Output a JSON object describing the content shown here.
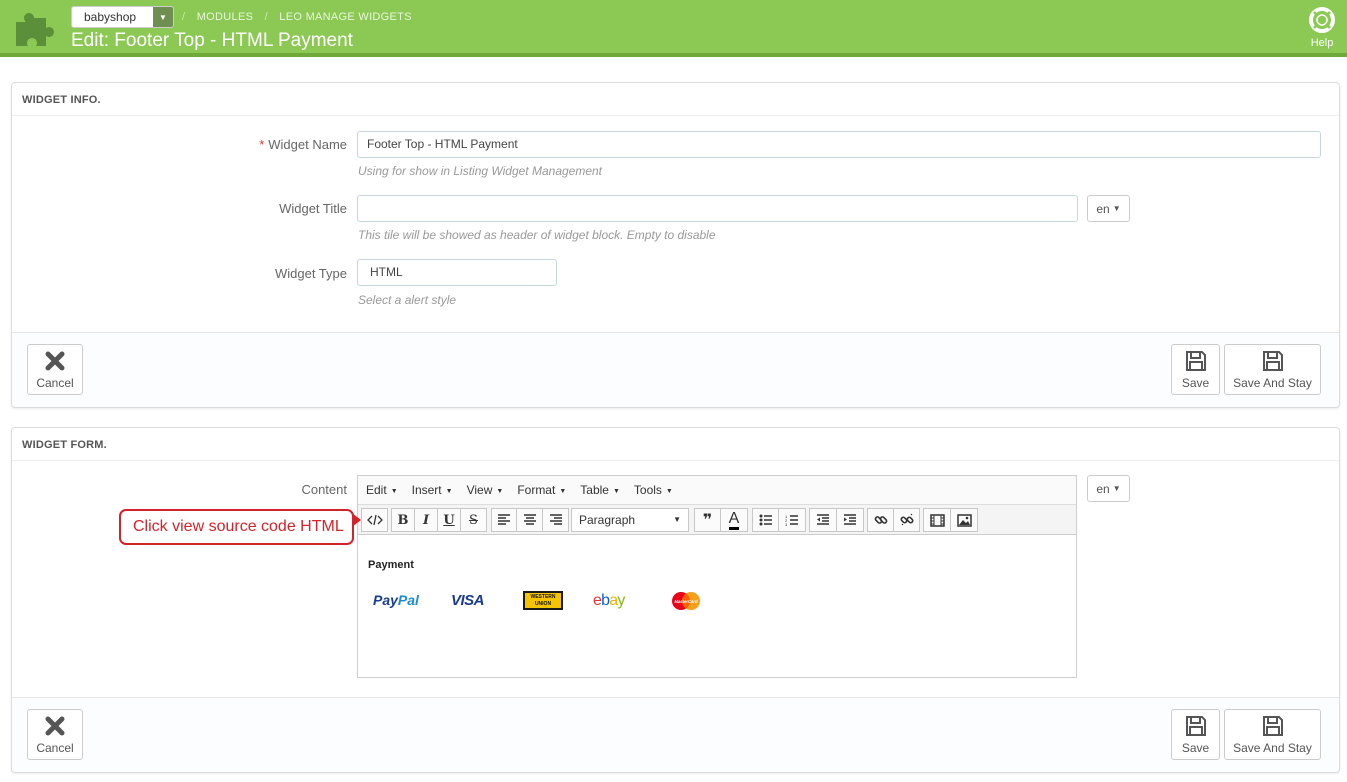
{
  "header": {
    "shop": "babyshop",
    "breadcrumb": [
      "MODULES",
      "LEO MANAGE WIDGETS"
    ],
    "title": "Edit: Footer Top - HTML Payment",
    "help_label": "Help"
  },
  "widget_info": {
    "heading": "WIDGET INFO.",
    "name_label": "Widget Name",
    "name_value": "Footer Top - HTML Payment",
    "name_hint": "Using for show in Listing Widget Management",
    "title_label": "Widget Title",
    "title_value": "",
    "title_hint": "This tile will be showed as header of widget block. Empty to disable",
    "type_label": "Widget Type",
    "type_value": "HTML",
    "type_hint": "Select a alert style",
    "lang": "en"
  },
  "widget_form": {
    "heading": "WIDGET FORM.",
    "content_label": "Content",
    "lang": "en",
    "menu": [
      "Edit",
      "Insert",
      "View",
      "Format",
      "Table",
      "Tools"
    ],
    "paragraph": "Paragraph",
    "content_heading": "Payment",
    "logos": {
      "paypal_a": "Pay",
      "paypal_b": "Pal",
      "visa": "VISA",
      "wu_a": "WESTERN",
      "wu_b": "UNION",
      "ebay": [
        "e",
        "b",
        "a",
        "y"
      ],
      "mastercard": "MasterCard"
    }
  },
  "buttons": {
    "cancel": "Cancel",
    "save": "Save",
    "save_stay": "Save And Stay"
  },
  "callout": "Click view source code HTML",
  "colors": {
    "header_bg": "#8bc954",
    "callout": "#d2232a"
  }
}
